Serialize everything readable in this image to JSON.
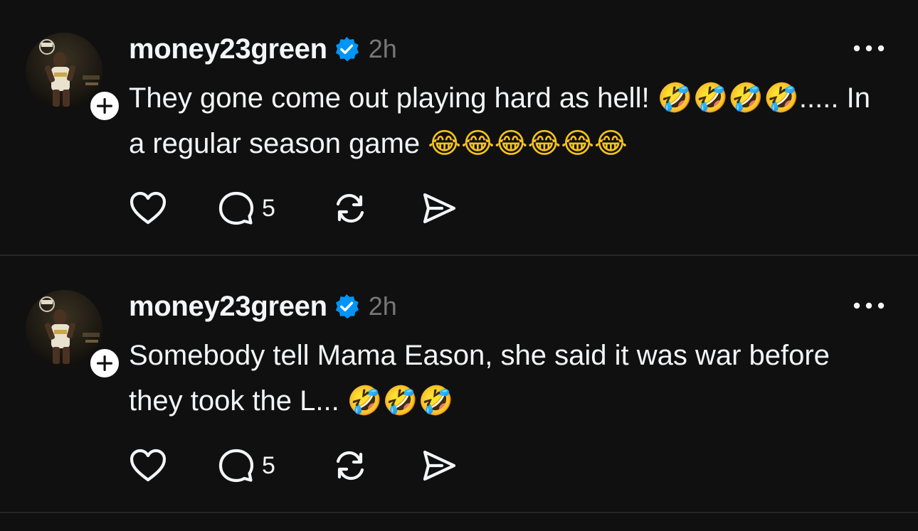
{
  "posts": [
    {
      "username": "money23green",
      "verified": true,
      "time": "2h",
      "text": "They gone come out playing hard as hell!",
      "text_emojis_1": "🤣🤣🤣🤣",
      "text_rest": "..... In a regular season game",
      "text_emojis_2": "😂😂😂😂😂😂",
      "reply_count": "5"
    },
    {
      "username": "money23green",
      "verified": true,
      "time": "2h",
      "text": "Somebody tell Mama Eason, she said it was war before they took the L...",
      "text_emojis_1": "🤣🤣🤣",
      "reply_count": "5"
    }
  ],
  "icons": {
    "verified": "verified-check-icon",
    "follow": "plus-icon",
    "more": "more-options-icon",
    "like": "heart-icon",
    "reply": "comment-bubble-icon",
    "repost": "repost-icon",
    "share": "send-icon"
  },
  "colors": {
    "background": "#101010",
    "text": "#f3f5f7",
    "muted": "#777777",
    "verified": "#0095f6",
    "divider": "#262626"
  }
}
